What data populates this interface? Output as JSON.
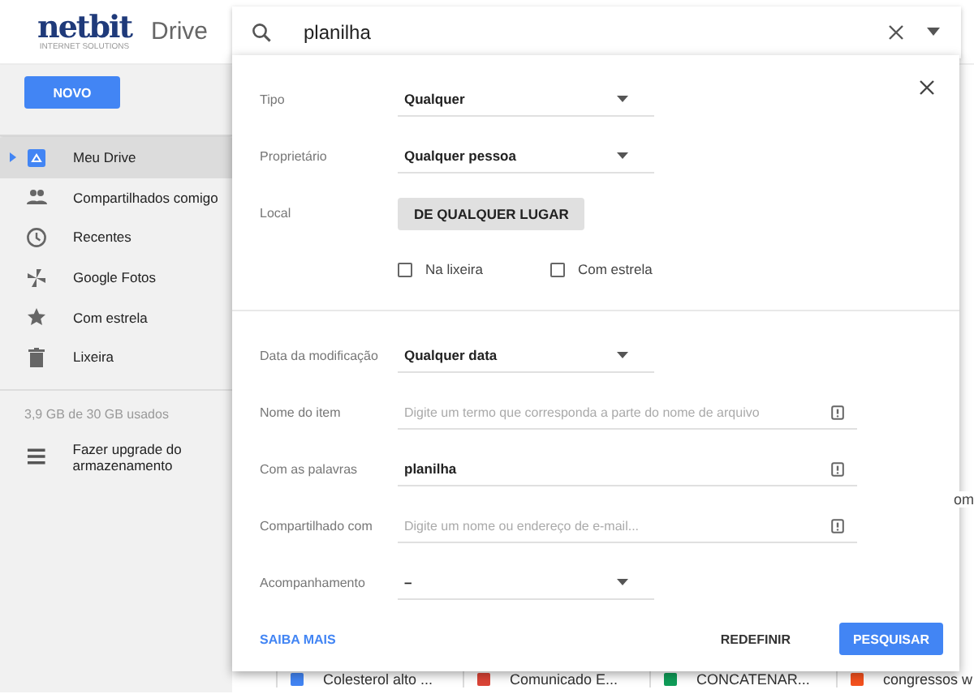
{
  "app": {
    "logo": "netbit",
    "logo_tagline": "INTERNET SOLUTIONS",
    "title": "Drive"
  },
  "search": {
    "value": "planilha"
  },
  "new_button": "NOVO",
  "sidebar": {
    "items": [
      {
        "label": "Meu Drive",
        "selected": true,
        "expandable": true
      },
      {
        "label": "Compartilhados comigo",
        "selected": false,
        "expandable": false
      },
      {
        "label": "Recentes",
        "selected": false,
        "expandable": false
      },
      {
        "label": "Google Fotos",
        "selected": false,
        "expandable": false
      },
      {
        "label": "Com estrela",
        "selected": false,
        "expandable": false
      },
      {
        "label": "Lixeira",
        "selected": false,
        "expandable": false
      }
    ],
    "storage": "3,9 GB de 30 GB usados",
    "upgrade": "Fazer upgrade do armazenamento"
  },
  "files": [
    {
      "name": "Colesterol alto ...",
      "color": "#4285f4"
    },
    {
      "name": "Comunicado E...",
      "color": "#db4437"
    },
    {
      "name": "CONCATENAR...",
      "color": "#0f9d58"
    },
    {
      "name": "congressos w",
      "color": "#f4511e"
    }
  ],
  "background_fragment": "om",
  "dialog": {
    "top_rows": [
      {
        "kind": "select",
        "label": "Tipo",
        "value": "Qualquer"
      },
      {
        "kind": "select",
        "label": "Proprietário",
        "value": "Qualquer pessoa"
      },
      {
        "kind": "button",
        "label": "Local",
        "value": "DE QUALQUER LUGAR"
      }
    ],
    "checkboxes": [
      {
        "label": "Na lixeira",
        "checked": false
      },
      {
        "label": "Com estrela",
        "checked": false
      }
    ],
    "bottom_rows": [
      {
        "kind": "select",
        "label": "Data da modificação",
        "value": "Qualquer data"
      },
      {
        "kind": "text",
        "label": "Nome do item",
        "placeholder": "Digite um termo que corresponda a parte do nome de arquivo"
      },
      {
        "kind": "text",
        "label": "Com as palavras",
        "value": "planilha"
      },
      {
        "kind": "text",
        "label": "Compartilhado com",
        "placeholder": "Digite um nome ou endereço de e-mail..."
      },
      {
        "kind": "select",
        "label": "Acompanhamento",
        "value": "–"
      }
    ],
    "learn_more": "SAIBA MAIS",
    "reset": "REDEFINIR",
    "submit": "PESQUISAR"
  }
}
